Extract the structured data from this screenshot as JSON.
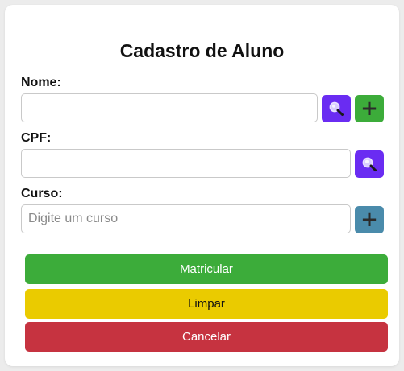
{
  "form": {
    "title": "Cadastro de Aluno",
    "nome_label": "Nome:",
    "nome_value": "",
    "cpf_label": "CPF:",
    "cpf_value": "",
    "curso_label": "Curso:",
    "curso_value": "",
    "curso_placeholder": "Digite um curso"
  },
  "icons": {
    "search": "magnifier-icon",
    "add": "plus-icon",
    "plus_glyph": "+"
  },
  "actions": {
    "matricular": "Matricular",
    "limpar": "Limpar",
    "cancelar": "Cancelar"
  },
  "colors": {
    "search_button": "#6a2cf2",
    "add_button_green": "#3cac3a",
    "add_button_blue": "#4a8bab",
    "matricular": "#3cac3a",
    "limpar": "#eacb00",
    "cancelar": "#c63340"
  }
}
